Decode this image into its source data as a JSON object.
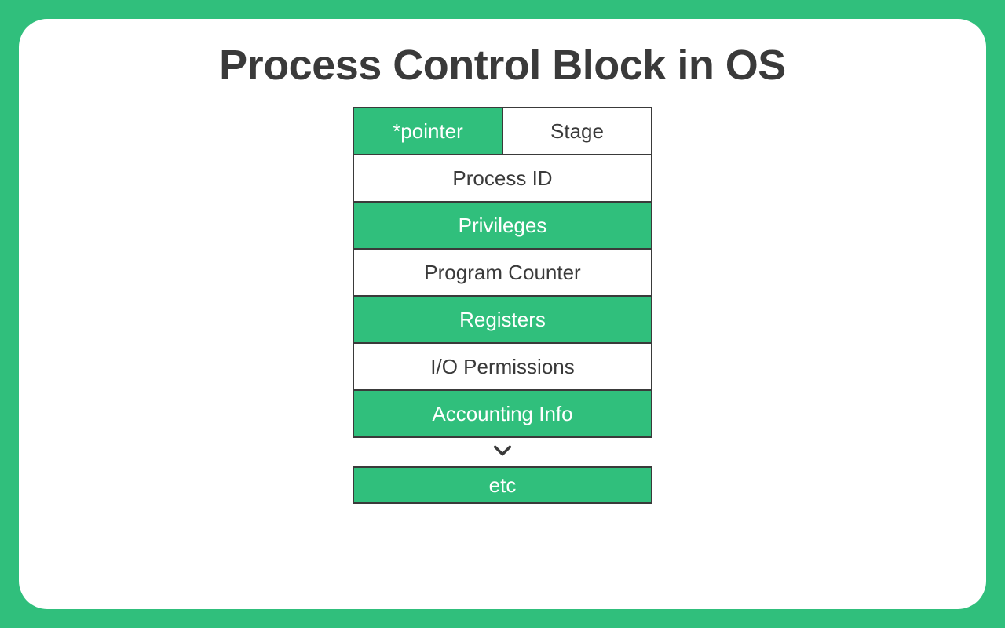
{
  "title": "Process Control Block in OS",
  "rows": {
    "r0a": "*pointer",
    "r0b": "Stage",
    "r1": "Process ID",
    "r2": "Privileges",
    "r3": "Program Counter",
    "r4": "Registers",
    "r5": "I/O Permissions",
    "r6": "Accounting Info"
  },
  "etc": "etc",
  "colors": {
    "accent": "#30bf7c",
    "text": "#3a3a3a",
    "bg": "#ffffff"
  }
}
